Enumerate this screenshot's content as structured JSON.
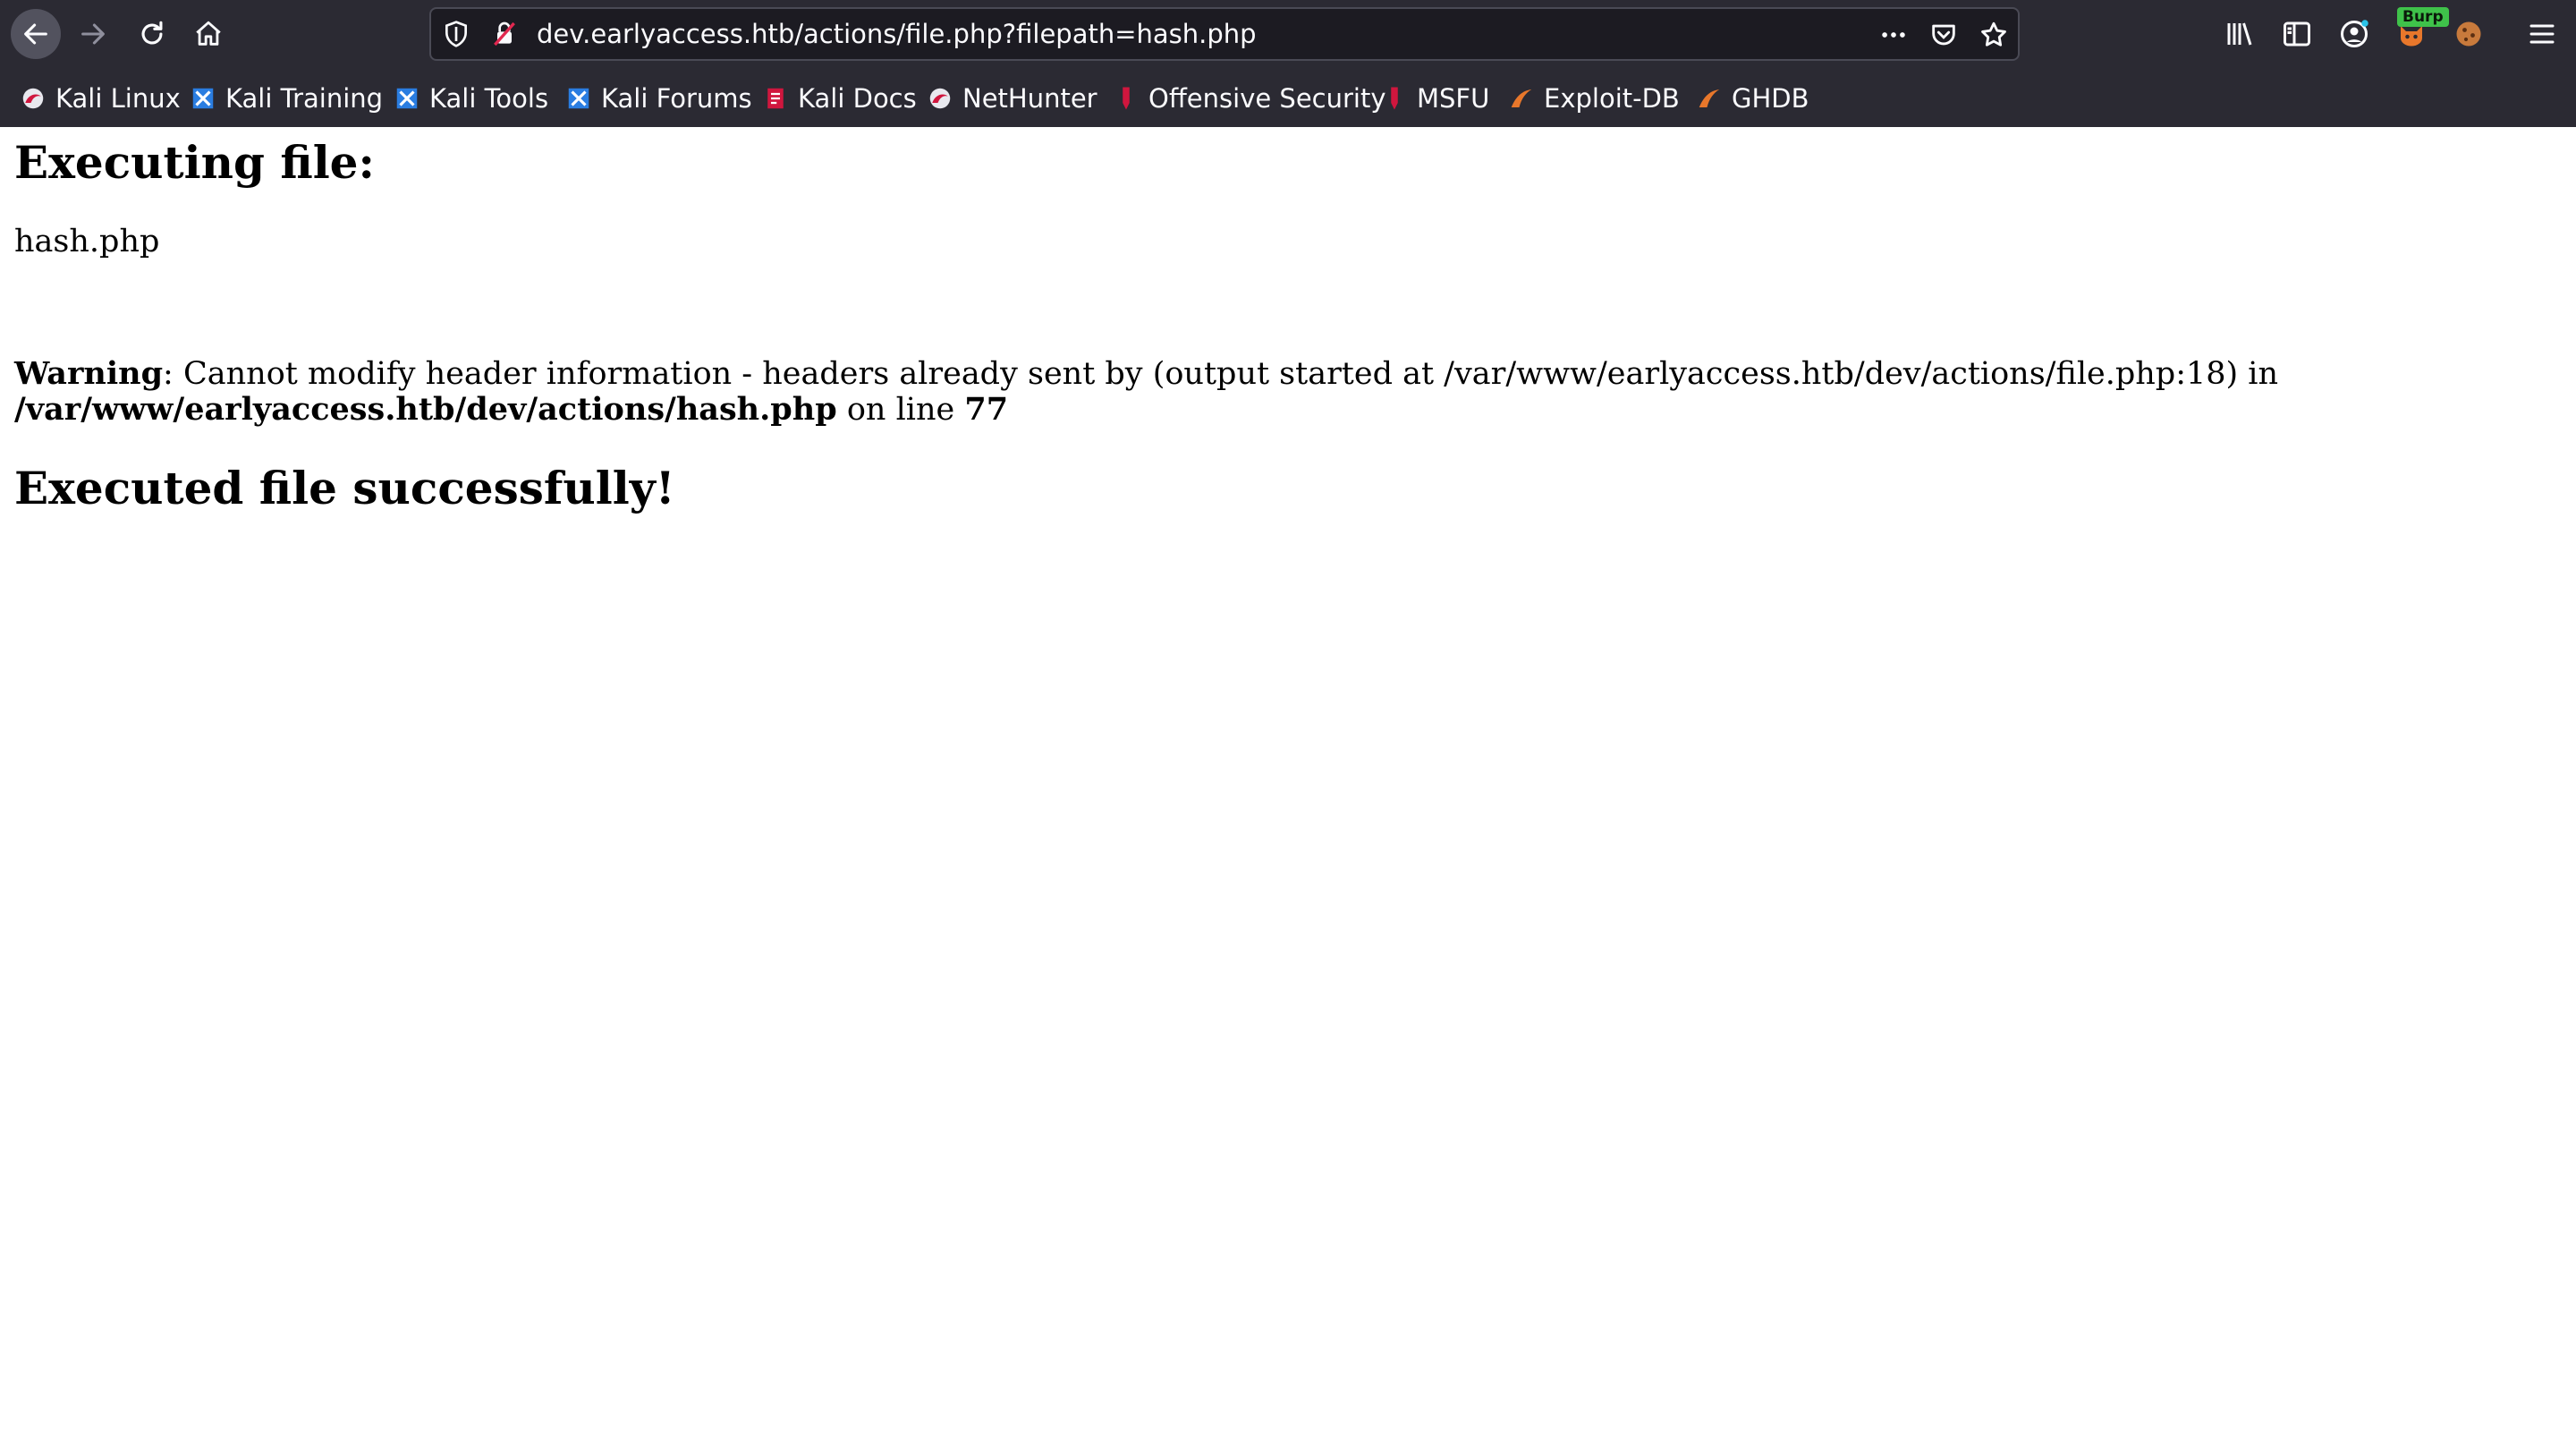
{
  "browser": {
    "url": "dev.earlyaccess.htb/actions/file.php?filepath=hash.php",
    "burp_badge": "Burp",
    "bookmarks": [
      {
        "label": "Kali Linux",
        "icon": "kali-dragon-icon"
      },
      {
        "label": "Kali Training",
        "icon": "kali-training-icon"
      },
      {
        "label": "Kali Tools",
        "icon": "kali-tools-icon"
      },
      {
        "label": "Kali Forums",
        "icon": "kali-forums-icon"
      },
      {
        "label": "Kali Docs",
        "icon": "kali-docs-icon"
      },
      {
        "label": "NetHunter",
        "icon": "nethunter-icon"
      },
      {
        "label": "Offensive Security",
        "icon": "offsec-icon"
      },
      {
        "label": "MSFU",
        "icon": "msfu-icon"
      },
      {
        "label": "Exploit-DB",
        "icon": "exploit-db-icon"
      },
      {
        "label": "GHDB",
        "icon": "ghdb-icon"
      }
    ],
    "colors": {
      "chrome_bg": "#2b2a33",
      "urlbar_bg": "#1c1b22",
      "text": "#fbfbfe"
    }
  },
  "page": {
    "heading_executing": "Executing file:",
    "filename": "hash.php",
    "warning_label": "Warning",
    "warning_text": ": Cannot modify header information - headers already sent by (output started at /var/www/earlyaccess.htb/dev/actions/file.php:18) in ",
    "warning_path": "/var/www/earlyaccess.htb/dev/actions/hash.php",
    "warning_online": " on line ",
    "warning_line": "77",
    "heading_success": "Executed file successfully!"
  }
}
